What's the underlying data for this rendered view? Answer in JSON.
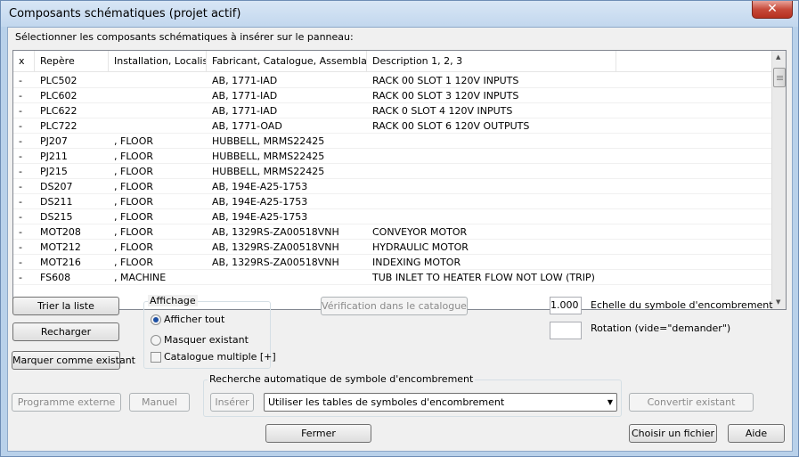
{
  "window": {
    "title": "Composants schématiques (projet actif)",
    "close_glyph": "✕"
  },
  "prompt": "Sélectionner les composants schématiques à insérer sur le panneau:",
  "table": {
    "columns": [
      "x",
      "Repère",
      "Installation, Localis...",
      "Fabricant, Catalogue, Assemblage",
      "Description 1, 2, 3"
    ],
    "rows": [
      [
        "-",
        "PLC502",
        "",
        "AB, 1771-IAD",
        "RACK 00 SLOT 1 120V INPUTS"
      ],
      [
        "-",
        "PLC602",
        "",
        "AB, 1771-IAD",
        "RACK 00 SLOT 3 120V INPUTS"
      ],
      [
        "-",
        "PLC622",
        "",
        "AB, 1771-IAD",
        "RACK 0 SLOT 4 120V INPUTS"
      ],
      [
        "-",
        "PLC722",
        "",
        "AB, 1771-OAD",
        "RACK 00 SLOT 6 120V OUTPUTS"
      ],
      [
        "-",
        "PJ207",
        ", FLOOR",
        "HUBBELL, MRMS22425",
        ""
      ],
      [
        "-",
        "PJ211",
        ", FLOOR",
        "HUBBELL, MRMS22425",
        ""
      ],
      [
        "-",
        "PJ215",
        ", FLOOR",
        "HUBBELL, MRMS22425",
        ""
      ],
      [
        "-",
        "DS207",
        ", FLOOR",
        "AB, 194E-A25-1753",
        ""
      ],
      [
        "-",
        "DS211",
        ", FLOOR",
        "AB, 194E-A25-1753",
        ""
      ],
      [
        "-",
        "DS215",
        ", FLOOR",
        "AB, 194E-A25-1753",
        ""
      ],
      [
        "-",
        "MOT208",
        ", FLOOR",
        "AB, 1329RS-ZA00518VNH",
        "CONVEYOR MOTOR"
      ],
      [
        "-",
        "MOT212",
        ", FLOOR",
        "AB, 1329RS-ZA00518VNH",
        "HYDRAULIC MOTOR"
      ],
      [
        "-",
        "MOT216",
        ", FLOOR",
        "AB, 1329RS-ZA00518VNH",
        "INDEXING MOTOR"
      ],
      [
        "-",
        "FS608",
        ", MACHINE",
        "",
        "TUB INLET TO HEATER FLOW NOT LOW (TRIP)"
      ]
    ]
  },
  "buttons": {
    "sort": "Trier la liste",
    "reload": "Recharger",
    "mark_existing": "Marquer comme existant",
    "catalog_check": "Vérification dans le catalogue",
    "external_program": "Programme externe",
    "manual": "Manuel",
    "insert": "Insérer",
    "convert_existing": "Convertir existant",
    "close": "Fermer",
    "choose_file": "Choisir un fichier",
    "help": "Aide"
  },
  "display_group": {
    "label": "Affichage",
    "show_all": "Afficher tout",
    "hide_existing": "Masquer existant",
    "multi_catalog": "Catalogue multiple [+]"
  },
  "scale": {
    "value": "1.000",
    "label": "Echelle du symbole d'encombrement"
  },
  "rotation": {
    "value": "",
    "label": "Rotation (vide=\"demander\")"
  },
  "auto_search": {
    "label": "Recherche automatique de symbole d'encombrement",
    "selected": "Utiliser les tables de symboles d'encombrement"
  }
}
